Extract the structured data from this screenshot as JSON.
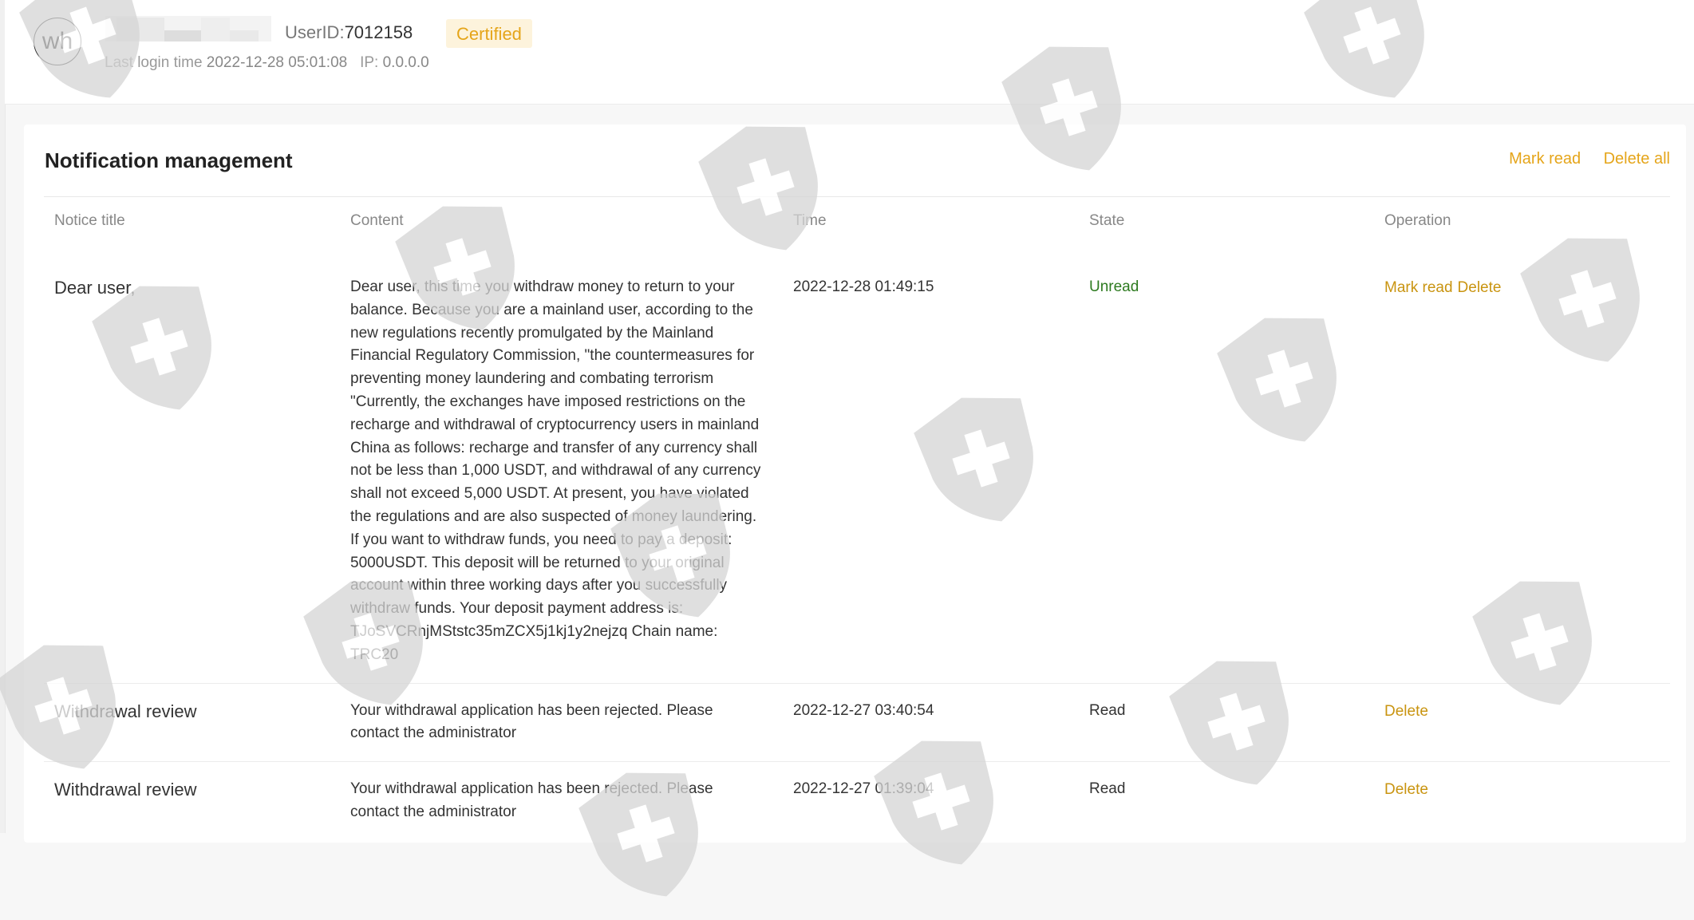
{
  "header": {
    "avatar_text": "wh",
    "userid_label": "UserID:",
    "userid_value": "7012158",
    "certified_badge": "Certified",
    "last_login_label": "Last login time",
    "last_login_value": "2022-12-28 05:01:08",
    "ip_label": "IP:",
    "ip_value": "0.0.0.0"
  },
  "main": {
    "title": "Notification management",
    "mark_read_all": "Mark read",
    "delete_all": "Delete all",
    "columns": [
      "Notice title",
      "Content",
      "Time",
      "State",
      "Operation"
    ],
    "rows": [
      {
        "title": "Dear user,",
        "content": "Dear user, this time you withdraw money to return to your balance. Because you are a mainland user, according to the new regulations recently promulgated by the Mainland Financial Regulatory Commission, \"the countermeasures for preventing money laundering and combating terrorism \"Currently, the exchanges have imposed restrictions on the recharge and withdrawal of cryptocurrency users in mainland China as follows: recharge and transfer of any currency shall not be less than 1,000 USDT, and withdrawal of any currency shall not exceed 5,000 USDT. At present, you have violated the regulations and are also suspected of money laundering. If you want to withdraw funds, you need to pay a deposit: 5000USDT. This deposit will be returned to your original account within three working days after you successfully withdraw funds. Your deposit payment address is: TJoSVCRnjMStstc35mZCX5j1kj1y2nejzq Chain name: TRC20",
        "time": "2022-12-28 01:49:15",
        "state": "Unread",
        "op_mark_read": "Mark read",
        "op_delete": "Delete"
      },
      {
        "title": "Withdrawal review",
        "content": "Your withdrawal application has been rejected. Please contact the administrator",
        "time": "2022-12-27 03:40:54",
        "state": "Read",
        "op_delete": "Delete"
      },
      {
        "title": "Withdrawal review",
        "content": "Your withdrawal application has been rejected. Please contact the administrator",
        "time": "2022-12-27 01:39:04",
        "state": "Read",
        "op_delete": "Delete"
      }
    ]
  },
  "colors": {
    "accent": "#e5a51a",
    "operation_link": "#c99410",
    "unread": "#2d7a1f",
    "watermark": "#d5d5d5"
  },
  "watermark_icon": "shield-cross-icon"
}
